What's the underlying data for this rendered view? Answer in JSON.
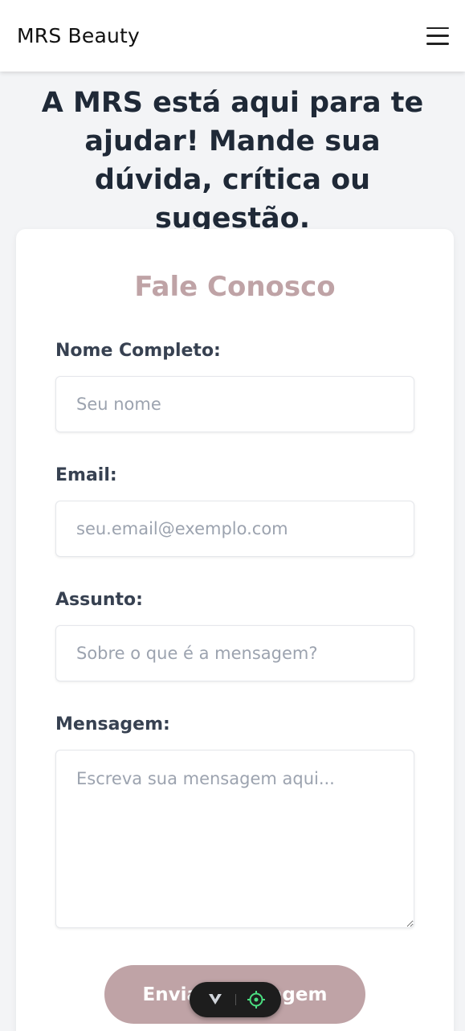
{
  "header": {
    "brand": "MRS Beauty",
    "menu_icon": "hamburger-menu-icon"
  },
  "hero": {
    "headline": "A MRS está aqui para te ajudar! Mande sua dúvida, crítica ou sugestão."
  },
  "form": {
    "title": "Fale Conosco",
    "fields": [
      {
        "label": "Nome Completo:",
        "placeholder": "Seu nome",
        "value": ""
      },
      {
        "label": "Email:",
        "placeholder": "seu.email@exemplo.com",
        "value": ""
      },
      {
        "label": "Assunto:",
        "placeholder": "Sobre o que é a mensagem?",
        "value": ""
      },
      {
        "label": "Mensagem:",
        "placeholder": "Escreva sua mensagem aqui...",
        "value": ""
      }
    ],
    "submit_label": "Enviar Mensagem"
  },
  "floating_toolbar": {
    "icons": [
      "chevron-down-icon",
      "crosshair-icon"
    ]
  },
  "colors": {
    "accent": "#bfa3a6",
    "background": "#f3f4f6",
    "card": "#ffffff",
    "label": "#374151",
    "placeholder": "#9ca3af"
  }
}
